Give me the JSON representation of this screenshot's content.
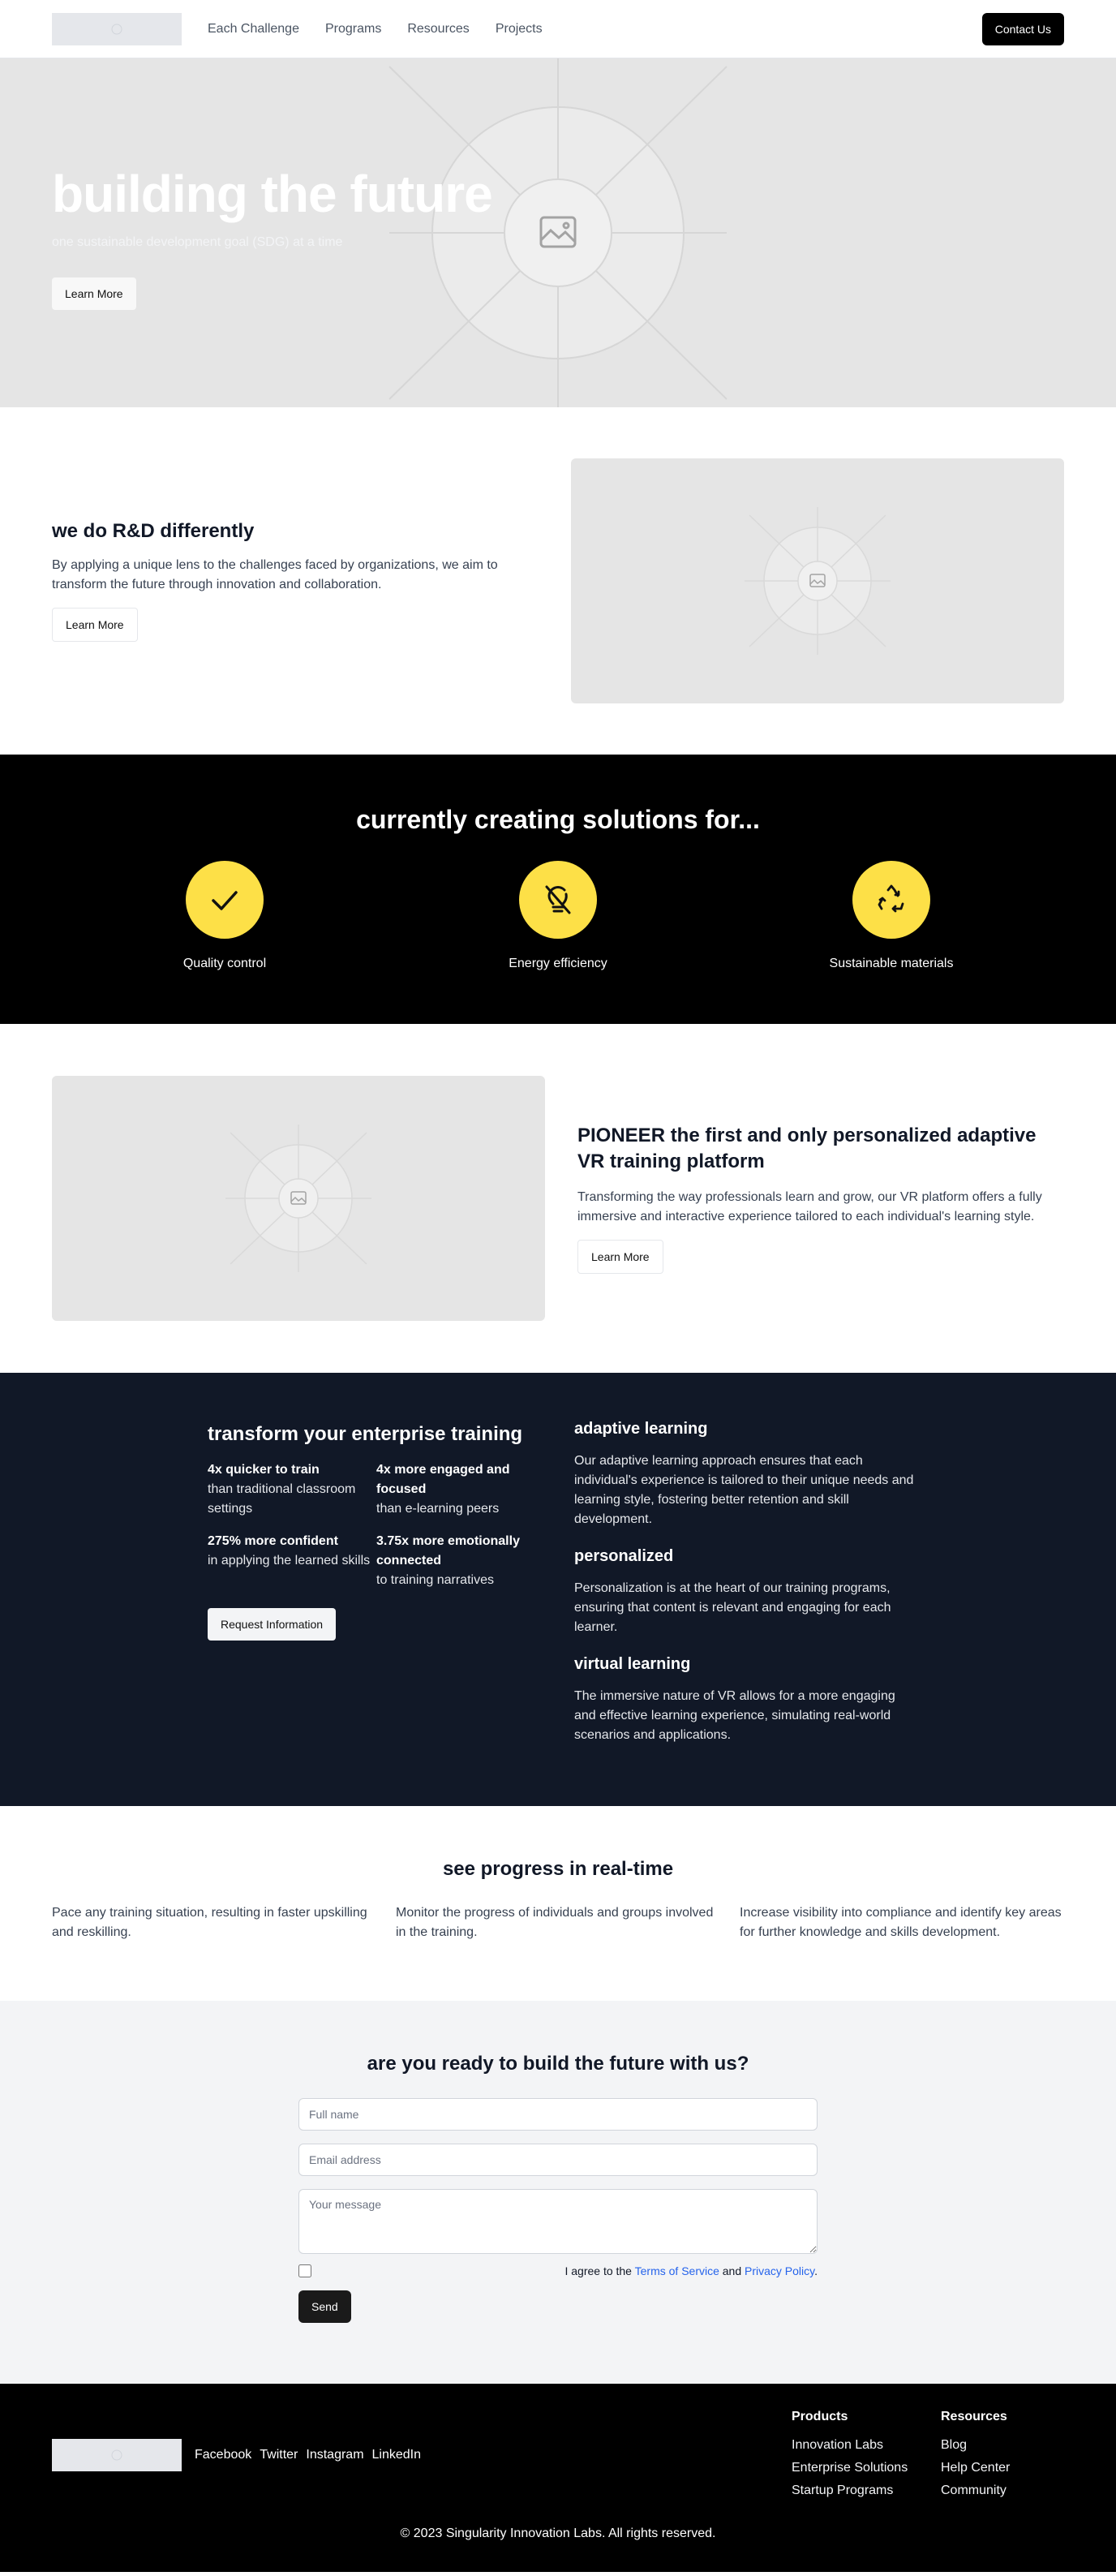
{
  "nav": {
    "links": [
      "Each Challenge",
      "Programs",
      "Resources",
      "Projects"
    ],
    "contact_label": "Contact Us"
  },
  "hero": {
    "title": "building the future",
    "subtitle": "one sustainable development goal (SDG) at a time",
    "cta": "Learn More"
  },
  "rd": {
    "title": "we do R&D differently",
    "body": "By applying a unique lens to the challenges faced by organizations, we aim to transform the future through innovation and collaboration.",
    "cta": "Learn More"
  },
  "solutions": {
    "title": "currently creating solutions for...",
    "items": [
      {
        "label": "Quality control",
        "icon": "check-icon"
      },
      {
        "label": "Energy efficiency",
        "icon": "lightbulb-off-icon"
      },
      {
        "label": "Sustainable materials",
        "icon": "recycle-icon"
      }
    ],
    "accent": "#fde047"
  },
  "pioneer": {
    "title": "PIONEER the first and only personalized adaptive VR training platform",
    "body": "Transforming the way professionals learn and grow, our VR platform offers a fully immersive and interactive experience tailored to each individual's learning style.",
    "cta": "Learn More"
  },
  "training": {
    "title": "transform your enterprise training",
    "stats": [
      {
        "bold": "4x quicker to train",
        "text": "than traditional classroom settings"
      },
      {
        "bold": "4x more engaged and focused",
        "text": "than e-learning peers"
      },
      {
        "bold": "275% more confident",
        "text": "in applying the learned skills"
      },
      {
        "bold": "3.75x more emotionally connected",
        "text": "to training narratives"
      }
    ],
    "cta": "Request Information",
    "blocks": [
      {
        "title": "adaptive learning",
        "body": "Our adaptive learning approach ensures that each individual's experience is tailored to their unique needs and learning style, fostering better retention and skill development."
      },
      {
        "title": "personalized",
        "body": "Personalization is at the heart of our training programs, ensuring that content is relevant and engaging for each learner."
      },
      {
        "title": "virtual learning",
        "body": "The immersive nature of VR allows for a more engaging and effective learning experience, simulating real-world scenarios and applications."
      }
    ],
    "bg": "#111827"
  },
  "progress": {
    "title": "see progress in real-time",
    "cols": [
      "Pace any training situation, resulting in faster upskilling and reskilling.",
      "Monitor the progress of individuals and groups involved in the training.",
      "Increase visibility into compliance and identify key areas for further knowledge and skills development."
    ]
  },
  "contact": {
    "title": "are you ready to build the future with us?",
    "name_placeholder": "Full name",
    "email_placeholder": "Email address",
    "message_placeholder": "Your message",
    "agree_prefix": "I agree to the",
    "terms": "Terms of Service",
    "and": "and",
    "privacy": "Privacy Policy",
    "period": ".",
    "send": "Send"
  },
  "footer": {
    "social": [
      "Facebook",
      "Twitter",
      "Instagram",
      "LinkedIn"
    ],
    "products_title": "Products",
    "products": [
      "Innovation Labs",
      "Enterprise Solutions",
      "Startup Programs"
    ],
    "resources_title": "Resources",
    "resources": [
      "Blog",
      "Help Center",
      "Community"
    ],
    "copyright": "© 2023 Singularity Innovation Labs. All rights reserved."
  }
}
